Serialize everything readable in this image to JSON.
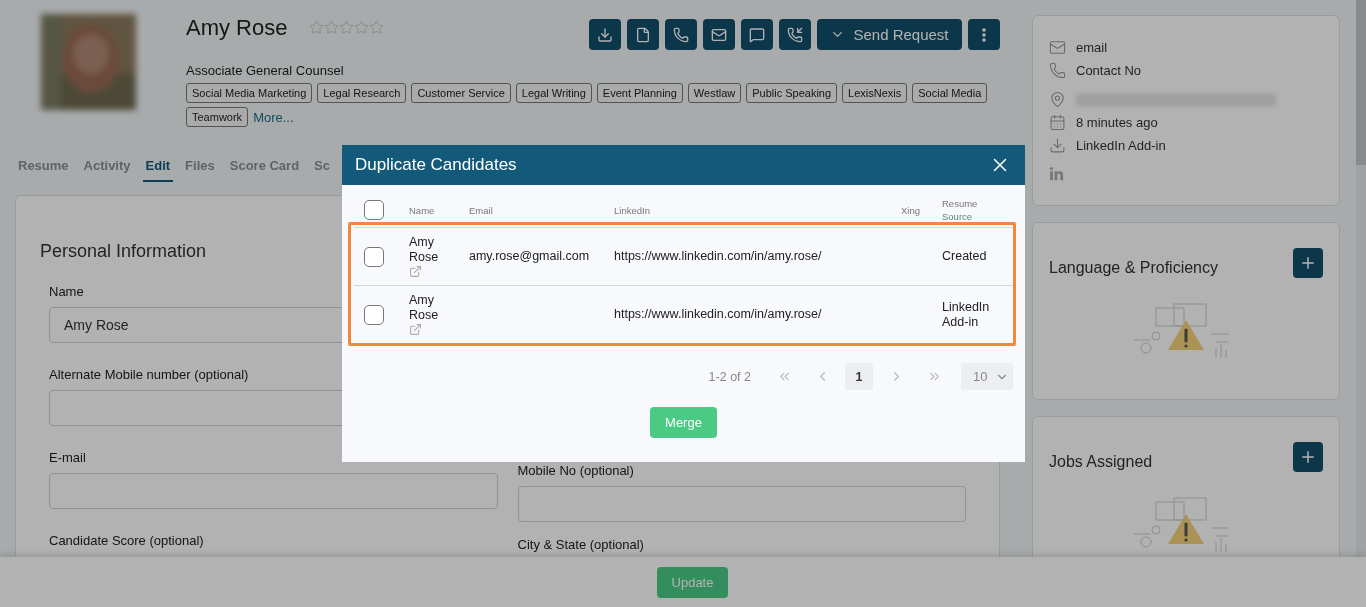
{
  "profile": {
    "name": "Amy Rose",
    "stars": 0,
    "title": "Associate General Counsel",
    "skills": [
      "Social Media Marketing",
      "Legal Research",
      "Customer Service",
      "Legal Writing",
      "Event Planning",
      "Westlaw",
      "Public Speaking",
      "LexisNexis",
      "Social Media",
      "Teamwork"
    ],
    "more_link": "More..."
  },
  "actions": {
    "send_request": "Send Request"
  },
  "tabs": [
    {
      "label": "Resume",
      "selected": false
    },
    {
      "label": "Activity",
      "selected": false
    },
    {
      "label": "Edit",
      "selected": true
    },
    {
      "label": "Files",
      "selected": false
    },
    {
      "label": "Score Card",
      "selected": false
    },
    {
      "label": "Sc",
      "selected": false
    }
  ],
  "personal_information": {
    "title": "Personal Information",
    "left_fields": [
      {
        "label": "Name",
        "value": "Amy Rose",
        "has_input": true
      },
      {
        "label": "Alternate Mobile number (optional)",
        "has_input": true
      },
      {
        "label": "E-mail",
        "has_input": true
      },
      {
        "label": "Candidate Score (optional)",
        "has_input": false
      }
    ],
    "right_fields": [
      {
        "label": "Mobile No (optional)",
        "has_input": true
      },
      {
        "label": "City & State (optional)",
        "has_input": false
      }
    ]
  },
  "contact": [
    {
      "kind": "email",
      "text": "email"
    },
    {
      "kind": "phone",
      "text": "Contact No"
    },
    {
      "kind": "location"
    },
    {
      "kind": "date",
      "text": "8 minutes ago"
    },
    {
      "kind": "source",
      "text": "LinkedIn Add-in"
    },
    {
      "kind": "linkedin"
    }
  ],
  "panels": [
    {
      "title": "Language & Proficiency"
    },
    {
      "title": "Jobs Assigned"
    }
  ],
  "footer": {
    "update_button": "Update"
  },
  "modal": {
    "title": "Duplicate Candidates",
    "select_all_checked": false,
    "columns": [
      "Name",
      "Email",
      "LinkedIn",
      "Xing",
      "Resume Source"
    ],
    "rows": [
      {
        "checked": false,
        "name": "Amy Rose",
        "email": "amy.rose@gmail.com",
        "linkedin": "https://www.linkedin.com/in/amy.rose/",
        "resume_source": "Created"
      },
      {
        "checked": false,
        "name": "Amy Rose",
        "linkedin": "https://www.linkedin.com/in/amy.rose/",
        "resume_source": "LinkedIn Add-in"
      }
    ],
    "pagination": {
      "range": "1-2 of 2",
      "pages": [
        {
          "label": "1",
          "selected": true
        }
      ],
      "page_size": "10"
    },
    "merge_button": "Merge"
  }
}
